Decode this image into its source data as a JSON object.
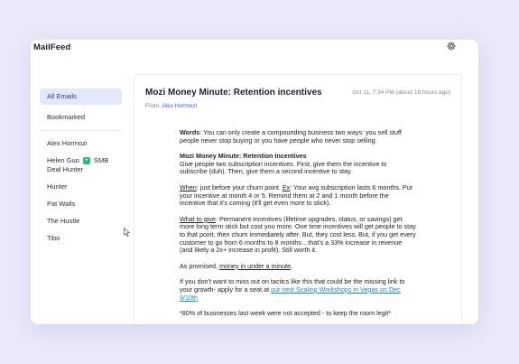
{
  "app": {
    "title": "MailFeed",
    "settings_icon": "gear-icon"
  },
  "sidebar": {
    "nav": [
      {
        "label": "All Emails",
        "active": true
      },
      {
        "label": "Bookmarked",
        "active": false
      }
    ],
    "feeds": [
      {
        "label": "Alex Hormozi"
      },
      {
        "label_a": "Helen Guo",
        "badge": "+",
        "label_b": "SMB",
        "label_c": "Deal Hunter"
      },
      {
        "label": "Hunter"
      },
      {
        "label": "Pat Walls"
      },
      {
        "label": "The Hustle"
      },
      {
        "label": "Tibo"
      }
    ]
  },
  "email": {
    "subject": "Mozi Money Minute: Retention incentives",
    "date": "Oct 11, 7:34 PM (about 18 hours ago)",
    "from_label": "From:",
    "from_name": "Alex Hormozi",
    "body": {
      "p1_bold": "Words",
      "p1_text": ": You can only create a compounding business two ways: you sell stuff people never stop buying or you have people who never stop selling.",
      "p2_title": "Mozi Money Minute: Retention Incentives",
      "p2_text": "Give people two subscription incentives. First, give them the incentive to subscribe (duh). Then, give them a second incentive to stay.",
      "p3_when": "When",
      "p3_a": ": just before your churn point. ",
      "p3_ex": "Ex",
      "p3_b": ": Your avg subscription lasts 6 months. Put your incentive at month 4 or 5. Remind them at 2 and 1 month before the incentive that it's coming (it'll get even more to stick).",
      "p4_what": "What to give",
      "p4_text": ": Permanent incentives (lifetime upgrades, status, or savings) get more long term stick but cost you more. One time incentives will get people to stay to that point, then churn immediately after. But, they cost less. But, if you get every customer to go from 6 months to 8 months…that's a 33% increase in revenue (and likely a 2x+ increase in profit). Still worth it.",
      "p5_a": "As promised, ",
      "p5_u": "money in under a minute",
      "p5_b": ".",
      "p6_a": "If you don't want to miss out on tactics like this that could be the missing link to your growth- apply for a seat at ",
      "p6_link": "our next Scaling Workshops in Vegas on Dec 9/10th",
      "p7": "*80% of businesses last week were not accepted - to keep the room legit*"
    }
  }
}
